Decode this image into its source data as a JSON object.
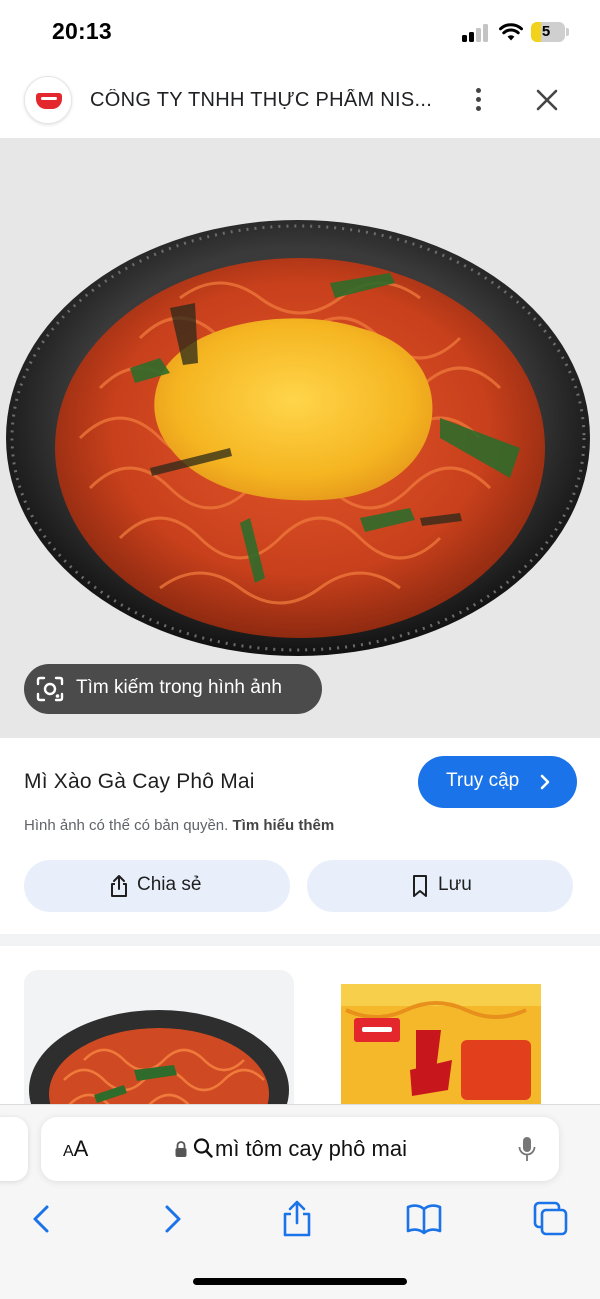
{
  "status_bar": {
    "time": "20:13",
    "battery_level": "5",
    "battery_color": "#f2d21b",
    "icons": [
      "cellular-signal-icon",
      "wifi-icon",
      "battery-icon"
    ]
  },
  "header": {
    "site_title": "CÔNG TY TNHH THỰC PHẨM NIS...",
    "logo_icon": "nissin-logo-icon",
    "more_icon": "more-vertical-icon",
    "close_icon": "close-icon"
  },
  "image_viewer": {
    "lens_button_label": "Tìm kiếm trong hình ảnh",
    "lens_icon": "lens-icon"
  },
  "result": {
    "title": "Mì Xào Gà Cay Phô Mai",
    "visit_button_label": "Truy cập",
    "copyright_notice": "Hình ảnh có thể có bản quyền.",
    "learn_more_label": "Tìm hiểu thêm",
    "share_label": "Chia sẻ",
    "save_label": "Lưu",
    "accent_color": "#1a73e8",
    "pill_color": "#e8effb"
  },
  "related": {
    "items": [
      {
        "icon": "noodle-dish-thumbnail"
      },
      {
        "icon": "nissin-package-thumbnail"
      }
    ]
  },
  "safari": {
    "text_size_label_big": "A",
    "text_size_label_small": "A",
    "search_query": "mì tôm cay phô mai",
    "icons": [
      "lock-icon",
      "search-icon",
      "mic-icon",
      "back-icon",
      "forward-icon",
      "share-icon",
      "bookmarks-icon",
      "tabs-icon"
    ]
  }
}
